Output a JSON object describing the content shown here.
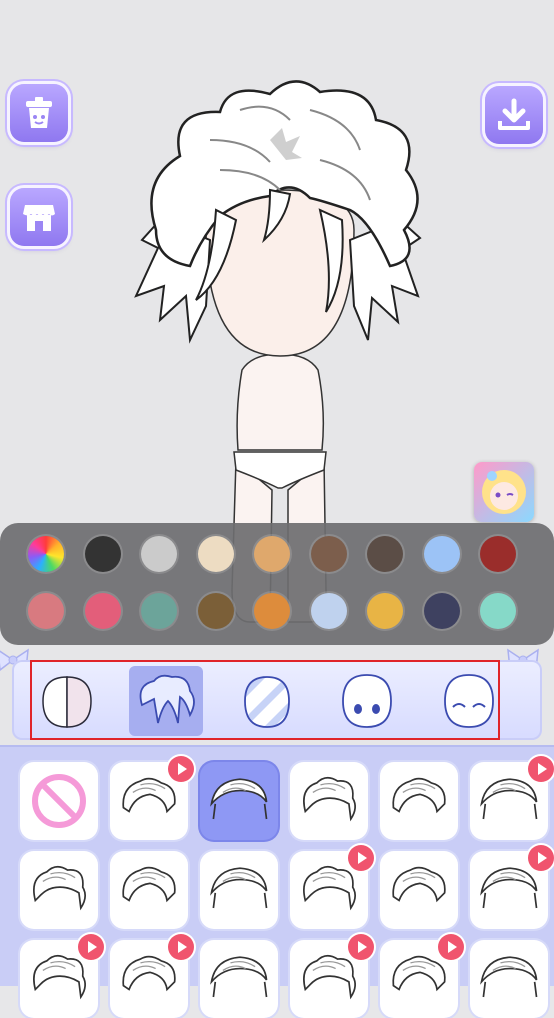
{
  "toolbar": {
    "left_buttons": [
      {
        "name": "trash-button",
        "icon": "trash-icon"
      },
      {
        "name": "shop-button",
        "icon": "store-icon"
      }
    ],
    "right_button": {
      "name": "download-button",
      "icon": "download-icon"
    }
  },
  "palette": {
    "colors": [
      "rainbow",
      "#333333",
      "#cbcbcb",
      "#eddcc2",
      "#dfa86c",
      "#7c5e4c",
      "#5b4d46",
      "#9cc3f6",
      "#9a2d2b",
      "#d87a80",
      "#e35e7a",
      "#6ca49a",
      "#7b5f38",
      "#dd8c3c",
      "#bfd2ee",
      "#e8b445",
      "#3e4160",
      "#86d9c8"
    ]
  },
  "categories": [
    {
      "name": "skin",
      "icon": "skin-tone-icon",
      "active": false
    },
    {
      "name": "hair",
      "icon": "hair-icon",
      "active": true
    },
    {
      "name": "pattern",
      "icon": "striped-head-icon",
      "active": false
    },
    {
      "name": "eyes",
      "icon": "face-eyes-icon",
      "active": false
    },
    {
      "name": "expression",
      "icon": "closed-eyes-icon",
      "active": false
    }
  ],
  "items": [
    {
      "icon": "none-icon",
      "locked": false,
      "selected": false
    },
    {
      "icon": "hair-style-1-icon",
      "locked": true,
      "selected": false
    },
    {
      "icon": "hair-style-2-icon",
      "locked": false,
      "selected": true
    },
    {
      "icon": "hair-style-3-icon",
      "locked": false,
      "selected": false
    },
    {
      "icon": "hair-style-4-icon",
      "locked": false,
      "selected": false
    },
    {
      "icon": "hair-style-5-icon",
      "locked": true,
      "selected": false
    },
    {
      "icon": "hair-style-6-icon",
      "locked": false,
      "selected": false
    },
    {
      "icon": "hair-style-7-icon",
      "locked": false,
      "selected": false
    },
    {
      "icon": "hair-style-8-icon",
      "locked": false,
      "selected": false
    },
    {
      "icon": "hair-style-9-icon",
      "locked": true,
      "selected": false
    },
    {
      "icon": "hair-style-10-icon",
      "locked": false,
      "selected": false
    },
    {
      "icon": "hair-style-11-icon",
      "locked": true,
      "selected": false
    },
    {
      "icon": "hair-style-12-icon",
      "locked": true,
      "selected": false
    },
    {
      "icon": "hair-style-13-icon",
      "locked": true,
      "selected": false
    },
    {
      "icon": "hair-style-14-icon",
      "locked": false,
      "selected": false
    },
    {
      "icon": "hair-style-15-icon",
      "locked": true,
      "selected": false
    },
    {
      "icon": "hair-style-16-icon",
      "locked": true,
      "selected": false
    },
    {
      "icon": "hair-style-17-icon",
      "locked": false,
      "selected": false
    }
  ]
}
